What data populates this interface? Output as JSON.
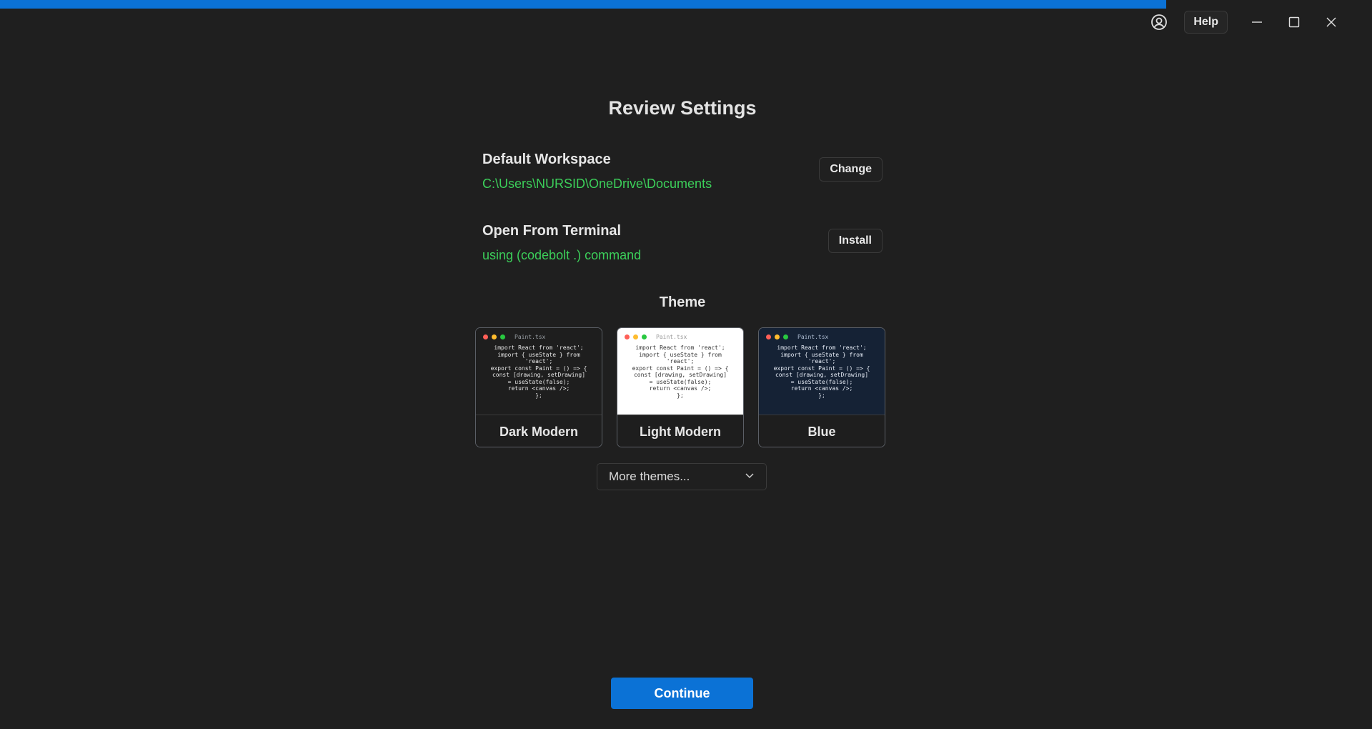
{
  "progress": {
    "percent": 85,
    "color": "#0b72d6"
  },
  "titlebar": {
    "account_icon": "user-circle-icon",
    "help_label": "Help",
    "minimize_icon": "minimize-icon",
    "maximize_icon": "maximize-icon",
    "close_icon": "close-icon"
  },
  "title": "Review Settings",
  "workspace": {
    "label": "Default Workspace",
    "path": "C:\\Users\\NURSID\\OneDrive\\Documents",
    "button": "Change"
  },
  "terminal": {
    "label": "Open From Terminal",
    "value": "using (codebolt .) command",
    "button": "Install"
  },
  "theme": {
    "heading": "Theme",
    "preview_file": "Paint.tsx",
    "preview_code": "import React from 'react';\nimport { useState } from\n'react';\nexport const Paint = () => {\nconst [drawing, setDrawing]\n= useState(false);\nreturn <canvas />;\n};",
    "cards": [
      {
        "name": "Dark Modern"
      },
      {
        "name": "Light Modern"
      },
      {
        "name": "Blue"
      }
    ],
    "more_label": "More themes..."
  },
  "continue_label": "Continue",
  "colors": {
    "accent": "#0b72d6",
    "value_green": "#3ccf5a",
    "background": "#1f1f1f"
  }
}
